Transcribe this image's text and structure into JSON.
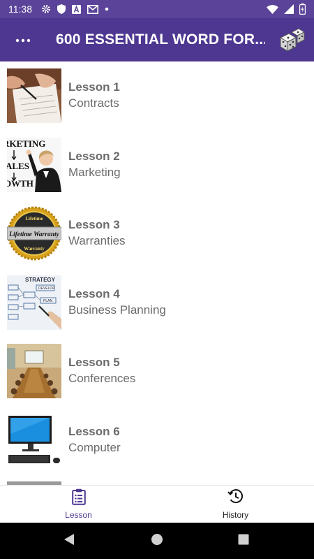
{
  "status_bar": {
    "time": "11:38",
    "icons_left": [
      "gear-icon",
      "shield-icon",
      "a-box-icon",
      "gmail-icon",
      "dot-icon"
    ],
    "icons_right": [
      "wifi-icon",
      "signal-icon",
      "battery-icon"
    ]
  },
  "app_bar": {
    "title": "600 ESSENTIAL WORD FOR...",
    "background": "#4e3791",
    "menu_icon": "more-dots-icon",
    "action_icon": "dice-icon"
  },
  "lessons": [
    {
      "number": "Lesson 1",
      "name": "Contracts",
      "image": "contract-signing-photo"
    },
    {
      "number": "Lesson 2",
      "name": "Marketing",
      "image": "marketing-whiteboard-photo"
    },
    {
      "number": "Lesson 3",
      "name": "Warranties",
      "image": "lifetime-warranty-seal"
    },
    {
      "number": "Lesson 4",
      "name": "Business Planning",
      "image": "strategy-diagram-photo"
    },
    {
      "number": "Lesson 5",
      "name": "Conferences",
      "image": "conference-room-photo"
    },
    {
      "number": "Lesson 6",
      "name": "Computer",
      "image": "desktop-computer-photo"
    }
  ],
  "seal": {
    "top": "Lifetime",
    "middle": "Lifetime Warranty",
    "bottom": "Warranty"
  },
  "marketing_words": [
    "RKETING",
    "ALES",
    "OWTH"
  ],
  "strategy_words": [
    "STRATEGY",
    "DEVELOP",
    "PLAN"
  ],
  "bottom_nav": {
    "tabs": [
      {
        "label": "Lesson",
        "icon": "clipboard-list-icon",
        "active": true
      },
      {
        "label": "History",
        "icon": "history-clock-icon",
        "active": false
      }
    ],
    "active_color": "#4e3791"
  },
  "system_nav": [
    "back-icon",
    "home-icon",
    "recents-icon"
  ]
}
